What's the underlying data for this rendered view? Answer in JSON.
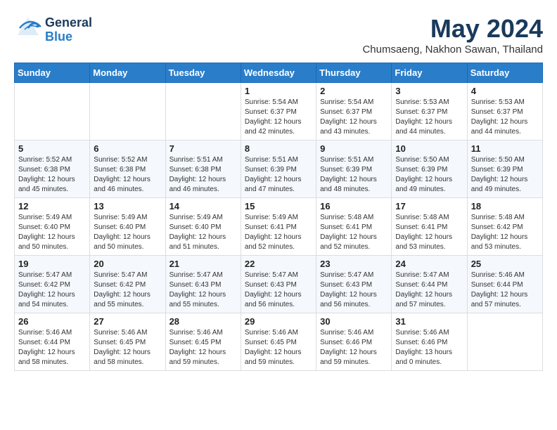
{
  "header": {
    "logo_general": "General",
    "logo_blue": "Blue",
    "title": "May 2024",
    "subtitle": "Chumsaeng, Nakhon Sawan, Thailand"
  },
  "calendar": {
    "days_of_week": [
      "Sunday",
      "Monday",
      "Tuesday",
      "Wednesday",
      "Thursday",
      "Friday",
      "Saturday"
    ],
    "weeks": [
      [
        {
          "day": "",
          "info": ""
        },
        {
          "day": "",
          "info": ""
        },
        {
          "day": "",
          "info": ""
        },
        {
          "day": "1",
          "info": "Sunrise: 5:54 AM\nSunset: 6:37 PM\nDaylight: 12 hours\nand 42 minutes."
        },
        {
          "day": "2",
          "info": "Sunrise: 5:54 AM\nSunset: 6:37 PM\nDaylight: 12 hours\nand 43 minutes."
        },
        {
          "day": "3",
          "info": "Sunrise: 5:53 AM\nSunset: 6:37 PM\nDaylight: 12 hours\nand 44 minutes."
        },
        {
          "day": "4",
          "info": "Sunrise: 5:53 AM\nSunset: 6:37 PM\nDaylight: 12 hours\nand 44 minutes."
        }
      ],
      [
        {
          "day": "5",
          "info": "Sunrise: 5:52 AM\nSunset: 6:38 PM\nDaylight: 12 hours\nand 45 minutes."
        },
        {
          "day": "6",
          "info": "Sunrise: 5:52 AM\nSunset: 6:38 PM\nDaylight: 12 hours\nand 46 minutes."
        },
        {
          "day": "7",
          "info": "Sunrise: 5:51 AM\nSunset: 6:38 PM\nDaylight: 12 hours\nand 46 minutes."
        },
        {
          "day": "8",
          "info": "Sunrise: 5:51 AM\nSunset: 6:39 PM\nDaylight: 12 hours\nand 47 minutes."
        },
        {
          "day": "9",
          "info": "Sunrise: 5:51 AM\nSunset: 6:39 PM\nDaylight: 12 hours\nand 48 minutes."
        },
        {
          "day": "10",
          "info": "Sunrise: 5:50 AM\nSunset: 6:39 PM\nDaylight: 12 hours\nand 49 minutes."
        },
        {
          "day": "11",
          "info": "Sunrise: 5:50 AM\nSunset: 6:39 PM\nDaylight: 12 hours\nand 49 minutes."
        }
      ],
      [
        {
          "day": "12",
          "info": "Sunrise: 5:49 AM\nSunset: 6:40 PM\nDaylight: 12 hours\nand 50 minutes."
        },
        {
          "day": "13",
          "info": "Sunrise: 5:49 AM\nSunset: 6:40 PM\nDaylight: 12 hours\nand 50 minutes."
        },
        {
          "day": "14",
          "info": "Sunrise: 5:49 AM\nSunset: 6:40 PM\nDaylight: 12 hours\nand 51 minutes."
        },
        {
          "day": "15",
          "info": "Sunrise: 5:49 AM\nSunset: 6:41 PM\nDaylight: 12 hours\nand 52 minutes."
        },
        {
          "day": "16",
          "info": "Sunrise: 5:48 AM\nSunset: 6:41 PM\nDaylight: 12 hours\nand 52 minutes."
        },
        {
          "day": "17",
          "info": "Sunrise: 5:48 AM\nSunset: 6:41 PM\nDaylight: 12 hours\nand 53 minutes."
        },
        {
          "day": "18",
          "info": "Sunrise: 5:48 AM\nSunset: 6:42 PM\nDaylight: 12 hours\nand 53 minutes."
        }
      ],
      [
        {
          "day": "19",
          "info": "Sunrise: 5:47 AM\nSunset: 6:42 PM\nDaylight: 12 hours\nand 54 minutes."
        },
        {
          "day": "20",
          "info": "Sunrise: 5:47 AM\nSunset: 6:42 PM\nDaylight: 12 hours\nand 55 minutes."
        },
        {
          "day": "21",
          "info": "Sunrise: 5:47 AM\nSunset: 6:43 PM\nDaylight: 12 hours\nand 55 minutes."
        },
        {
          "day": "22",
          "info": "Sunrise: 5:47 AM\nSunset: 6:43 PM\nDaylight: 12 hours\nand 56 minutes."
        },
        {
          "day": "23",
          "info": "Sunrise: 5:47 AM\nSunset: 6:43 PM\nDaylight: 12 hours\nand 56 minutes."
        },
        {
          "day": "24",
          "info": "Sunrise: 5:47 AM\nSunset: 6:44 PM\nDaylight: 12 hours\nand 57 minutes."
        },
        {
          "day": "25",
          "info": "Sunrise: 5:46 AM\nSunset: 6:44 PM\nDaylight: 12 hours\nand 57 minutes."
        }
      ],
      [
        {
          "day": "26",
          "info": "Sunrise: 5:46 AM\nSunset: 6:44 PM\nDaylight: 12 hours\nand 58 minutes."
        },
        {
          "day": "27",
          "info": "Sunrise: 5:46 AM\nSunset: 6:45 PM\nDaylight: 12 hours\nand 58 minutes."
        },
        {
          "day": "28",
          "info": "Sunrise: 5:46 AM\nSunset: 6:45 PM\nDaylight: 12 hours\nand 59 minutes."
        },
        {
          "day": "29",
          "info": "Sunrise: 5:46 AM\nSunset: 6:45 PM\nDaylight: 12 hours\nand 59 minutes."
        },
        {
          "day": "30",
          "info": "Sunrise: 5:46 AM\nSunset: 6:46 PM\nDaylight: 12 hours\nand 59 minutes."
        },
        {
          "day": "31",
          "info": "Sunrise: 5:46 AM\nSunset: 6:46 PM\nDaylight: 13 hours\nand 0 minutes."
        },
        {
          "day": "",
          "info": ""
        }
      ]
    ]
  }
}
